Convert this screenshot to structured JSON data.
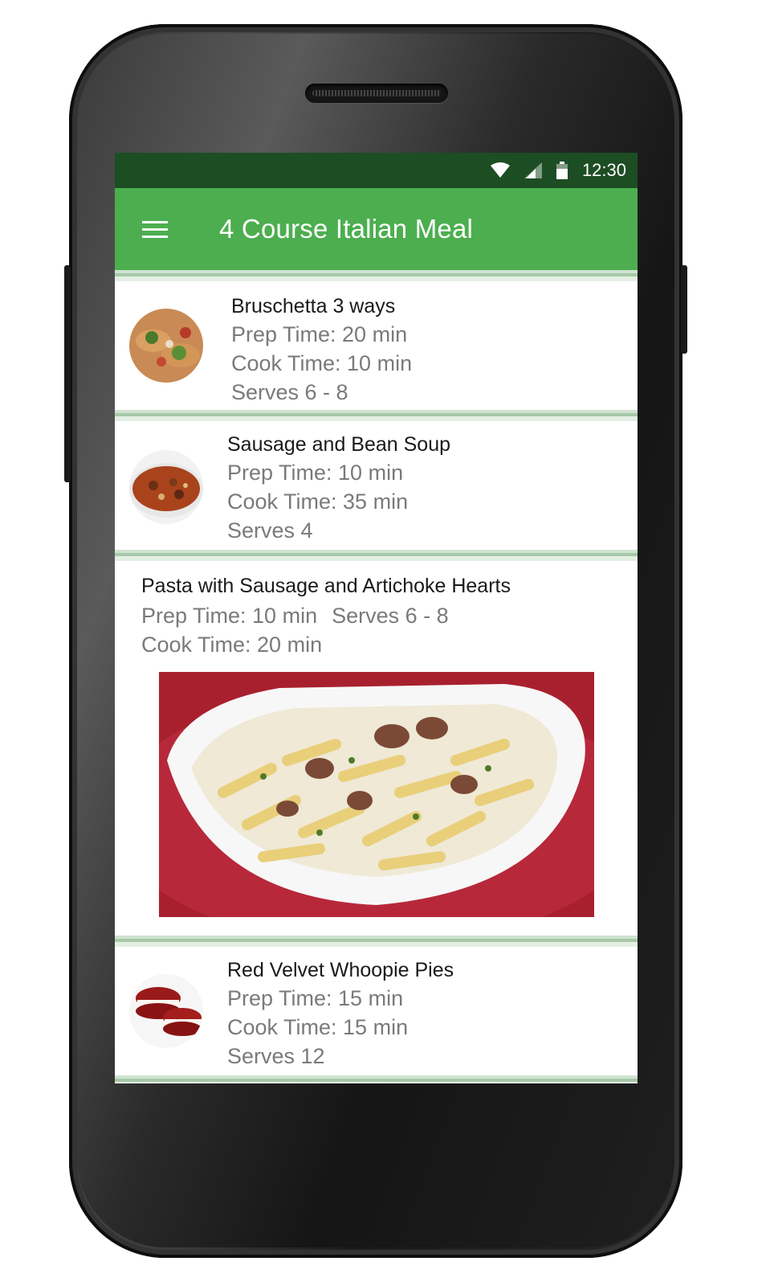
{
  "status_bar": {
    "time": "12:30"
  },
  "app_bar": {
    "title": "4 Course Italian Meal"
  },
  "recipes": [
    {
      "title": "Bruschetta 3 ways",
      "prep": "Prep Time: 20 min",
      "cook": "Cook Time: 10 min",
      "serves": "Serves 6 - 8",
      "icon": "bruschetta-photo"
    },
    {
      "title": "Sausage and Bean Soup",
      "prep": "Prep Time: 10 min",
      "cook": "Cook Time: 35 min",
      "serves": "Serves 4",
      "icon": "soup-photo"
    },
    {
      "title": "Pasta with Sausage and Artichoke Hearts",
      "prep": "Prep Time: 10 min",
      "cook": "Cook Time: 20 min",
      "serves": "Serves 6 - 8",
      "icon": "pasta-photo"
    },
    {
      "title": "Red Velvet Whoopie Pies",
      "prep": "Prep Time: 15 min",
      "cook": "Cook Time: 15 min",
      "serves": "Serves 12",
      "icon": "whoopie-pie-photo"
    }
  ],
  "colors": {
    "app_bar": "#4cae4f",
    "status_bar": "#1d4d23"
  }
}
